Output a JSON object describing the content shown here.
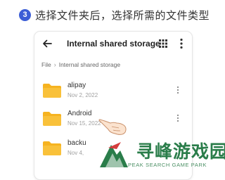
{
  "step": {
    "number": "3",
    "text": "选择文件夹后，选择所需的文件类型"
  },
  "topbar": {
    "title": "Internal shared storage"
  },
  "breadcrumb": {
    "root": "File",
    "current": "Internal shared storage"
  },
  "folders": [
    {
      "name": "alipay",
      "date": "Nov 2, 2022"
    },
    {
      "name": "Android",
      "date": "Nov 15, 2022"
    },
    {
      "name": "backu",
      "date": "Nov 4,"
    }
  ],
  "watermark": {
    "title": "寻峰游戏园",
    "subtitle": "PEAK SEARCH GAME PARK"
  },
  "colors": {
    "accent": "#3b5dd6",
    "folder": "#f6b320",
    "watermark": "#2a7d4a"
  },
  "icons": [
    "back-arrow-icon",
    "grid-icon",
    "more-vertical-icon",
    "folder-icon",
    "chevron-right-icon",
    "pointing-hand-icon",
    "mountain-logo-icon"
  ]
}
